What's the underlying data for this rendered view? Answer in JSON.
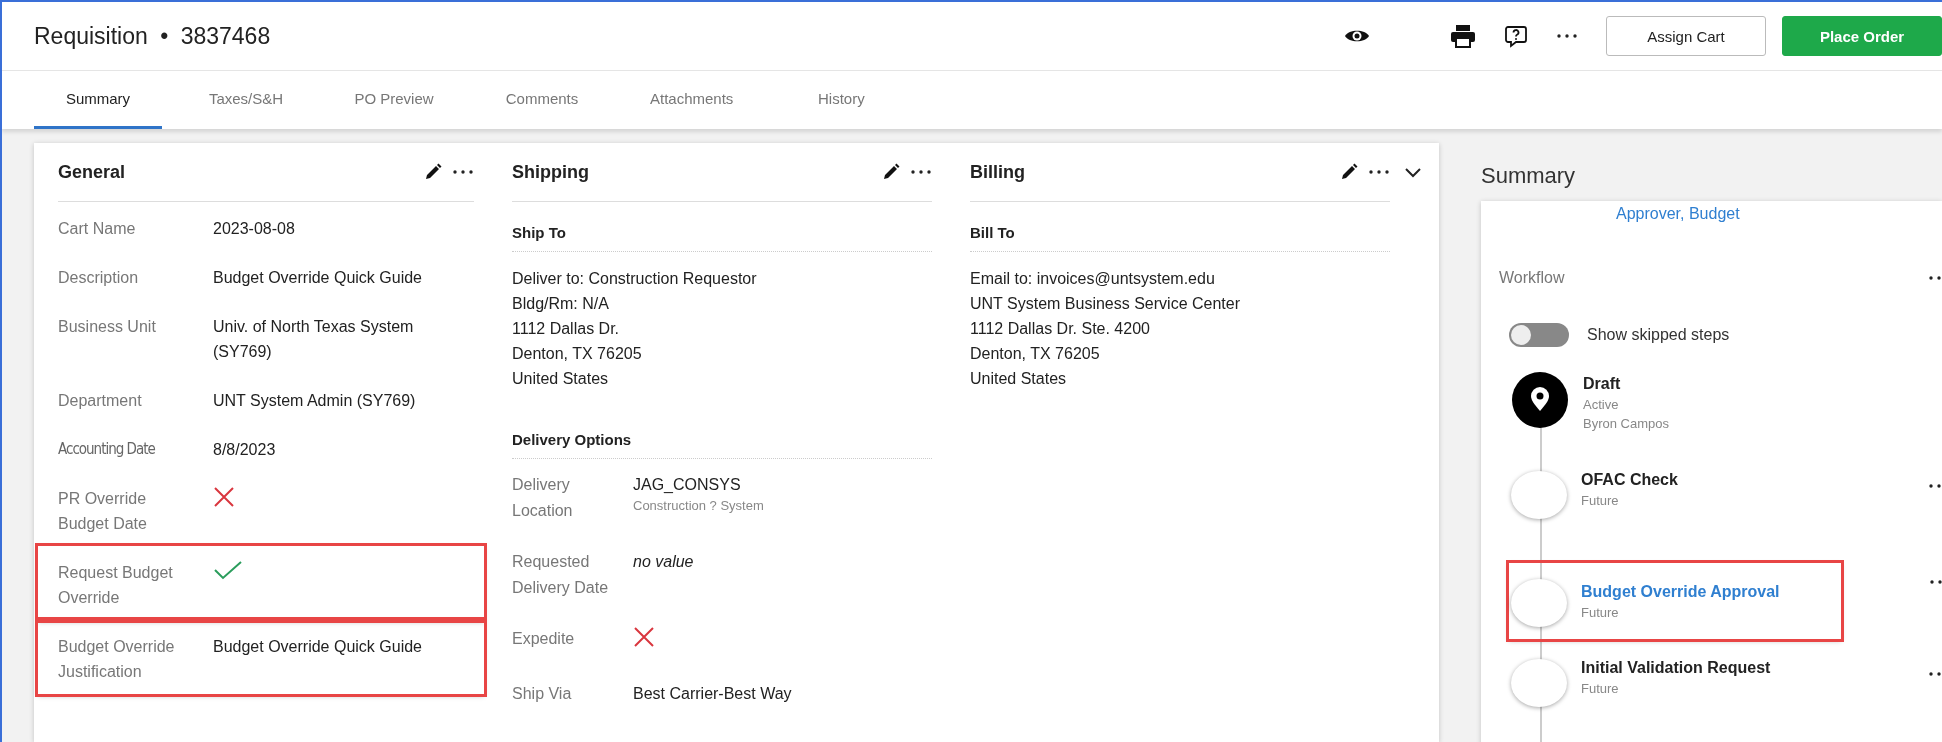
{
  "header": {
    "title": "Requisition",
    "separator": "•",
    "number": "3837468",
    "buttons": [
      {
        "label": "Assign Cart",
        "kind": "secondary"
      },
      {
        "label": "Place Order",
        "kind": "primary"
      }
    ]
  },
  "tabs": [
    {
      "label": "Summary",
      "selected": true
    },
    {
      "label": "Taxes/S&H",
      "selected": false
    },
    {
      "label": "PO Preview",
      "selected": false
    },
    {
      "label": "Comments",
      "selected": false
    },
    {
      "label": "Attachments",
      "selected": false
    },
    {
      "label": "History",
      "selected": false
    }
  ],
  "general": {
    "title": "General",
    "fields": [
      {
        "label": "Cart Name",
        "kind": "text",
        "value": "2023-08-08",
        "highlighted": false
      },
      {
        "label": "Description",
        "kind": "text",
        "value": "Budget Override Quick Guide",
        "highlighted": false
      },
      {
        "label": "Business Unit",
        "kind": "text",
        "value": "Univ. of North Texas System (SY769)",
        "highlighted": false
      },
      {
        "label": "Department",
        "kind": "text",
        "value": "UNT System Admin (SY769)",
        "highlighted": false
      },
      {
        "label": "Accounting Date",
        "kind": "text",
        "value": "8/8/2023",
        "highlighted": false
      },
      {
        "label": "PR Override Budget Date",
        "kind": "flag",
        "checked": false,
        "highlighted": false
      },
      {
        "label": "Request Budget Override",
        "kind": "flag",
        "checked": true,
        "highlighted": true
      },
      {
        "label": "Budget Override Justification",
        "kind": "text",
        "value": "Budget Override Quick Guide",
        "highlighted": true
      }
    ]
  },
  "shipping": {
    "title": "Shipping",
    "ship_to": {
      "heading": "Ship To",
      "lines": [
        "Deliver to: Construction Requestor",
        "Bldg/Rm: N/A",
        "1112 Dallas Dr.",
        "Denton, TX 76205",
        "United States"
      ]
    },
    "delivery_options": {
      "heading": "Delivery Options",
      "fields": [
        {
          "label": "Delivery Location",
          "kind": "text",
          "value": "JAG_CONSYS",
          "note": "Construction ? System"
        },
        {
          "label": "Requested Delivery Date",
          "kind": "empty",
          "value": "no value"
        },
        {
          "label": "Expedite",
          "kind": "flag",
          "checked": false
        },
        {
          "label": "Ship Via",
          "kind": "text",
          "value": "Best Carrier-Best Way"
        }
      ]
    }
  },
  "billing": {
    "title": "Billing",
    "expanded": true,
    "bill_to": {
      "heading": "Bill To",
      "lines": [
        "Email to: invoices@untsystem.edu",
        "UNT System Business Service Center",
        "1112 Dallas Dr. Ste. 4200",
        "Denton, TX 76205",
        "United States"
      ]
    }
  },
  "summary": {
    "title": "Summary",
    "approver_link": "Approver, Budget",
    "workflow": {
      "label": "Workflow",
      "toggle": {
        "label": "Show skipped steps",
        "on": false
      },
      "steps": [
        {
          "title": "Draft",
          "current": true,
          "status": "Active",
          "person": "Byron Campos",
          "menu": false,
          "link": false,
          "highlighted": false
        },
        {
          "title": "OFAC Check",
          "current": false,
          "status": "Future",
          "menu": true,
          "link": false,
          "highlighted": false
        },
        {
          "title": "Budget Override Approval",
          "current": false,
          "status": "Future",
          "menu": true,
          "link": true,
          "highlighted": true
        },
        {
          "title": "Initial Validation Request",
          "current": false,
          "status": "Future",
          "menu": true,
          "link": false,
          "highlighted": false
        }
      ]
    }
  }
}
